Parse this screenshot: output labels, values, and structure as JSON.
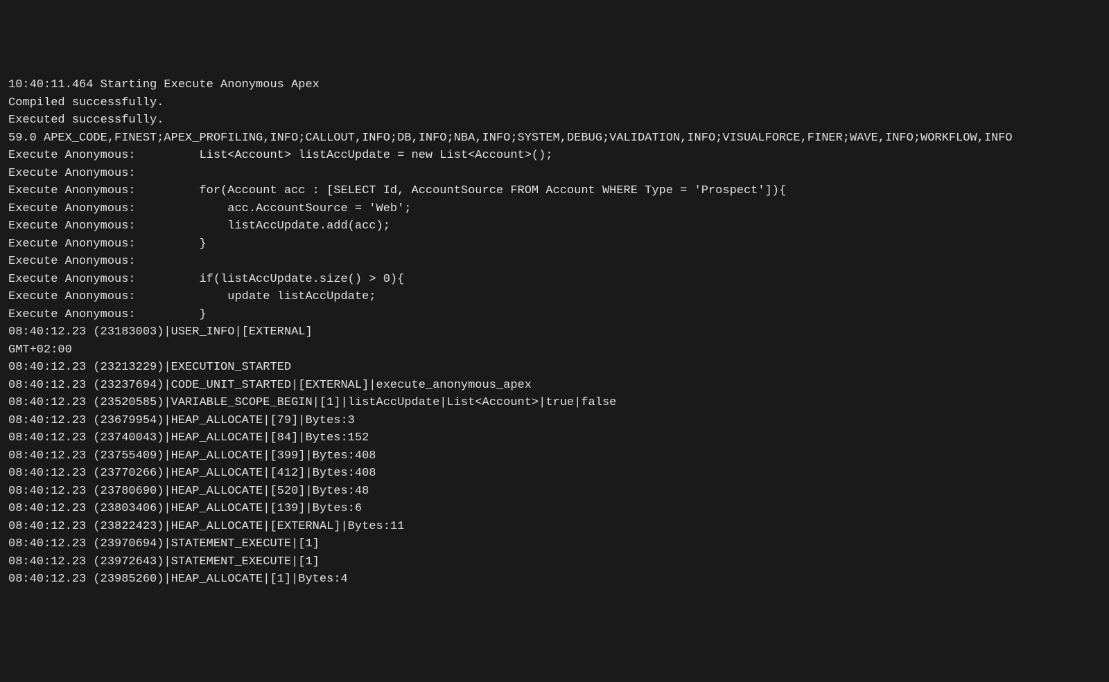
{
  "log": {
    "lines": [
      "10:40:11.464 Starting Execute Anonymous Apex",
      "",
      "Compiled successfully.",
      "Executed successfully.",
      "",
      "59.0 APEX_CODE,FINEST;APEX_PROFILING,INFO;CALLOUT,INFO;DB,INFO;NBA,INFO;SYSTEM,DEBUG;VALIDATION,INFO;VISUALFORCE,FINER;WAVE,INFO;WORKFLOW,INFO",
      "Execute Anonymous:         List<Account> listAccUpdate = new List<Account>();",
      "Execute Anonymous: ",
      "Execute Anonymous:         for(Account acc : [SELECT Id, AccountSource FROM Account WHERE Type = 'Prospect']){",
      "Execute Anonymous:             acc.AccountSource = 'Web';",
      "Execute Anonymous:             listAccUpdate.add(acc);",
      "Execute Anonymous:         }",
      "Execute Anonymous: ",
      "Execute Anonymous:         if(listAccUpdate.size() > 0){",
      "Execute Anonymous:             update listAccUpdate;",
      "Execute Anonymous:         }",
      "08:40:12.23 (23183003)|USER_INFO|[EXTERNAL]",
      "GMT+02:00",
      "08:40:12.23 (23213229)|EXECUTION_STARTED",
      "08:40:12.23 (23237694)|CODE_UNIT_STARTED|[EXTERNAL]|execute_anonymous_apex",
      "08:40:12.23 (23520585)|VARIABLE_SCOPE_BEGIN|[1]|listAccUpdate|List<Account>|true|false",
      "08:40:12.23 (23679954)|HEAP_ALLOCATE|[79]|Bytes:3",
      "08:40:12.23 (23740043)|HEAP_ALLOCATE|[84]|Bytes:152",
      "08:40:12.23 (23755409)|HEAP_ALLOCATE|[399]|Bytes:408",
      "08:40:12.23 (23770266)|HEAP_ALLOCATE|[412]|Bytes:408",
      "08:40:12.23 (23780690)|HEAP_ALLOCATE|[520]|Bytes:48",
      "08:40:12.23 (23803406)|HEAP_ALLOCATE|[139]|Bytes:6",
      "08:40:12.23 (23822423)|HEAP_ALLOCATE|[EXTERNAL]|Bytes:11",
      "08:40:12.23 (23970694)|STATEMENT_EXECUTE|[1]",
      "08:40:12.23 (23972643)|STATEMENT_EXECUTE|[1]",
      "08:40:12.23 (23985260)|HEAP_ALLOCATE|[1]|Bytes:4"
    ]
  }
}
